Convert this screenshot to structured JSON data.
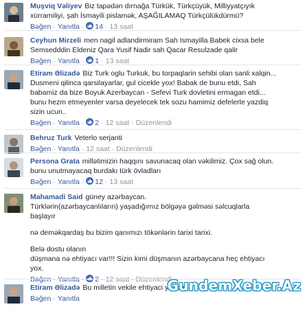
{
  "ui": {
    "like": "Bəğen",
    "reply": "Yanıtla",
    "dot": "·",
    "edited": "Düzenlendi"
  },
  "comments": [
    {
      "name": "Muşviq Vəliyev",
      "lines": [
        "Biz tapədən dırnağa Türkük, Türkçüyük, Milliyyatçıyık",
        "xürramiliyi, şah İsmayili pislamək, AŞAĞILAMAQ Türkçülükdürmü?"
      ],
      "likes": "14",
      "time": "13 saat",
      "edited": false
    },
    {
      "name": "Ceyhun Mirzeli",
      "lines": [
        "men nagil adlandirmiram Sah Ismayilla Babek cixsa bele",
        "Semsedddin Eldeniz Qara Yusif Nadir sah Qacar Resulzade qalir"
      ],
      "likes": "1",
      "time": "13 saat",
      "edited": false
    },
    {
      "name": "Etiram Əlizadə",
      "lines": [
        "Biz Turk oglu Turkuk, bu torpaqlarin sehibi olan sanli xalqin...",
        "Dusmeni qilinca qarsilayarlar, gul cicekle yox! Babak de bunu etdi, Sah",
        "babamiz da bize Boyuk Azerbaycan - Sefevi Turk dovletini ermagan etdi...",
        "bunu hezm etmeyenler varsa deyelecek tek sozu hamimiz defelerle yazdiq",
        "sizin ucun.."
      ],
      "likes": "2",
      "time": "12 saat",
      "edited": true
    },
    {
      "name": "Behruz Turk",
      "lines": [
        "Veterlo serjanti"
      ],
      "likes": "",
      "time": "12 saat",
      "edited": true
    },
    {
      "name": "Persona Grata",
      "lines": [
        "millətimizin haqqını savunacaq olan vəkilimiz. Çox sağ olun.",
        "bunu unutmayacaq burdakı türk övladları"
      ],
      "likes": "12",
      "time": "13 saat",
      "edited": false
    },
    {
      "name": "Mahamadi Said",
      "lines": [
        "güney azərbaycan.",
        "Türklərin(azərbaycanlıların) yaşadığımız bölgəyə gəlməsi səlcuqlarla",
        "başlayır",
        "",
        "nə deməkqardaş bu bizim qanımızı tökənlərin tarixi tarixi.",
        "",
        "Belə dostu olanın",
        "düşmana nə ehtiyacı var!!! Sizin kimi düşmanın azərbaycana heç ehtiyacı",
        "yox."
      ],
      "likes": "2",
      "time": "12 saat",
      "edited": true
    },
    {
      "name": "Etiram Əlizadə",
      "lines": [
        "Bu milletin vekile ehtiyaci yoxdur"
      ],
      "likes": "",
      "time": "",
      "edited": false
    }
  ],
  "watermark": "GundemXeber.Az"
}
